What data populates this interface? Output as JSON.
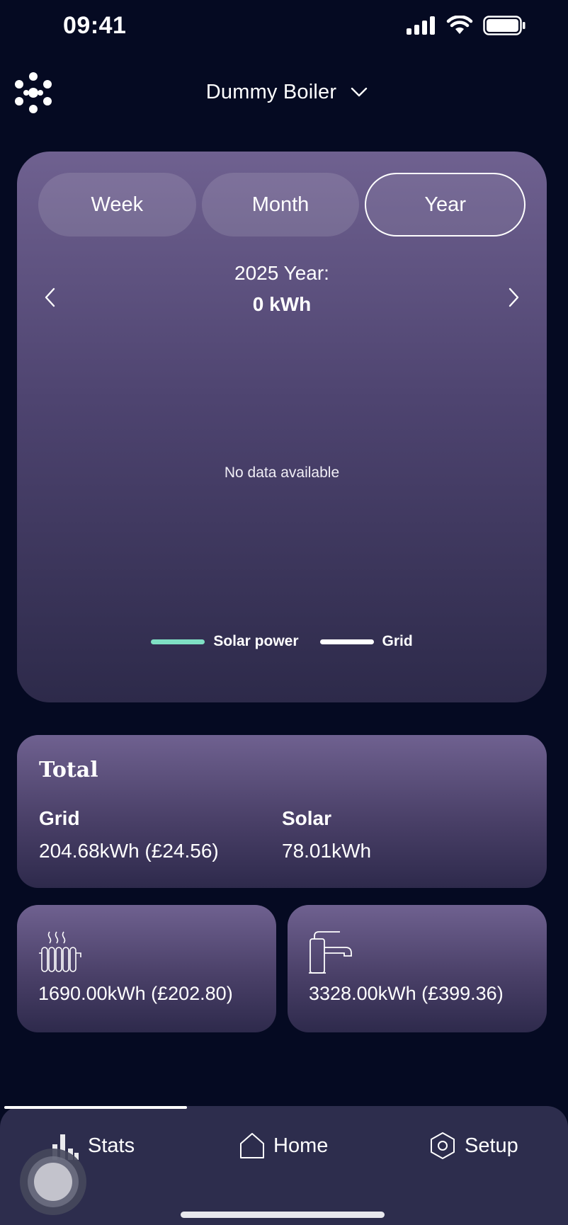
{
  "status_bar": {
    "time": "09:41"
  },
  "header": {
    "device_name": "Dummy Boiler"
  },
  "period_tabs": {
    "week": "Week",
    "month": "Month",
    "year": "Year",
    "active": "year"
  },
  "chart": {
    "period_label": "2025 Year:",
    "period_total": "0 kWh",
    "empty_message": "No data available",
    "legend": [
      {
        "label": "Solar power",
        "color": "#7fe0c4"
      },
      {
        "label": "Grid",
        "color": "#ffffff"
      }
    ]
  },
  "chart_data": {
    "type": "line",
    "title": "2025 Year:",
    "series": [
      {
        "name": "Solar power",
        "values": []
      },
      {
        "name": "Grid",
        "values": []
      }
    ],
    "legend_position": "bottom-center"
  },
  "totals": {
    "title": "Total",
    "grid": {
      "label": "Grid",
      "value": "204.68kWh (£24.56)"
    },
    "solar": {
      "label": "Solar",
      "value": "78.01kWh"
    }
  },
  "usage": {
    "heating": {
      "icon": "radiator-icon",
      "value": "1690.00kWh (£202.80)"
    },
    "hot_water": {
      "icon": "tap-icon",
      "value": "3328.00kWh (£399.36)"
    }
  },
  "bottom_nav": {
    "items": [
      {
        "label": "Stats",
        "icon": "stats-icon",
        "active": true
      },
      {
        "label": "Home",
        "icon": "home-icon"
      },
      {
        "label": "Setup",
        "icon": "setup-icon"
      }
    ]
  },
  "colors": {
    "background": "#050a22",
    "accent_solar": "#7fe0c4",
    "nav_bg": "#2d2d4d"
  }
}
